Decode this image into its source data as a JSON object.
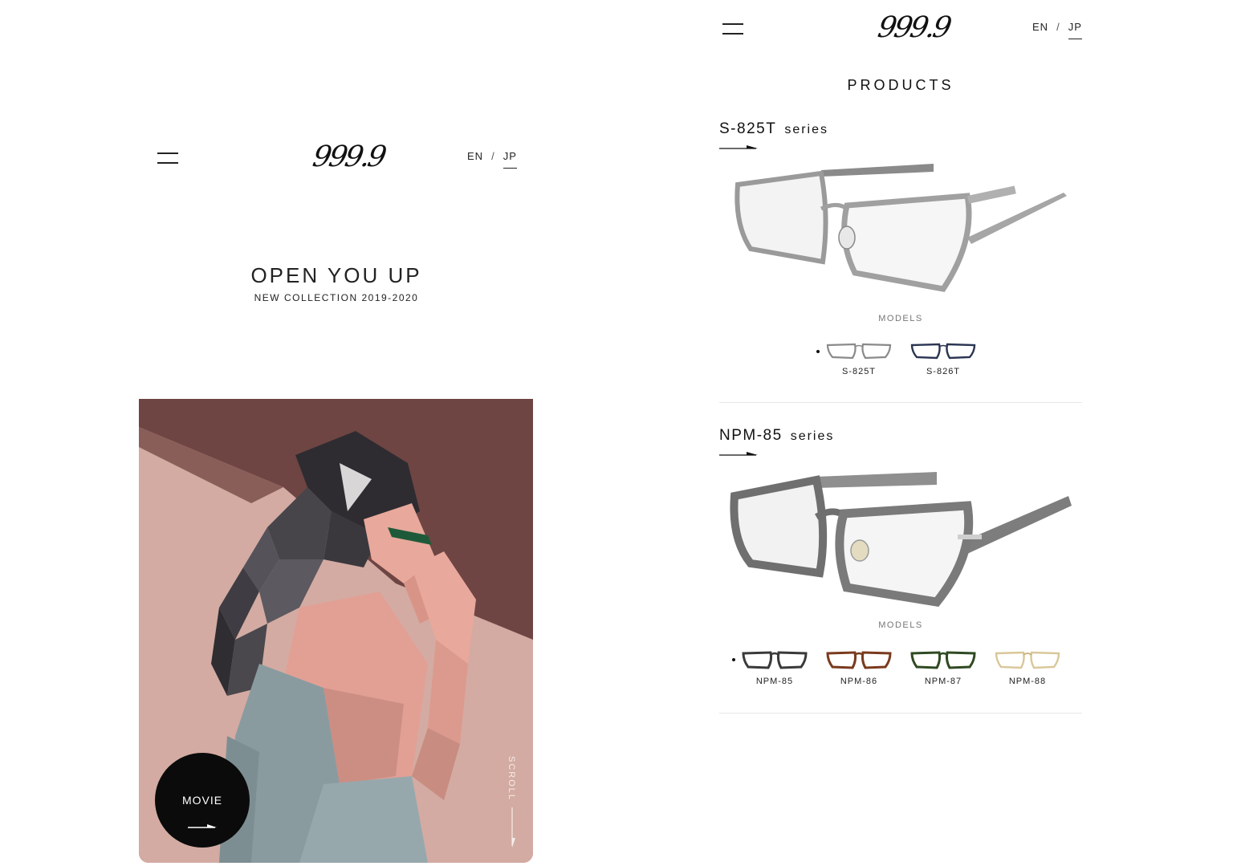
{
  "left_panel": {
    "header": {
      "logo_text": "999.9",
      "lang_en": "EN",
      "lang_separator": "/",
      "lang_jp": "JP"
    },
    "hero": {
      "title": "OPEN YOU UP",
      "subtitle": "NEW COLLECTION 2019-2020"
    },
    "movie_button": {
      "label": "MOVIE"
    },
    "scroll_label": "SCROLL"
  },
  "right_panel": {
    "header": {
      "logo_text": "999.9",
      "lang_en": "EN",
      "lang_separator": "/",
      "lang_jp": "JP"
    },
    "products_title": "PRODUCTS",
    "series": [
      {
        "name": "S-825T",
        "suffix": "series",
        "models_label": "MODELS",
        "models": [
          {
            "code": "S-825T",
            "color": "#8a8a8a",
            "selected": true
          },
          {
            "code": "S-826T",
            "color": "#2b3552",
            "selected": false
          }
        ]
      },
      {
        "name": "NPM-85",
        "suffix": "series",
        "models_label": "MODELS",
        "models": [
          {
            "code": "NPM-85",
            "color": "#3a3a3a",
            "selected": true
          },
          {
            "code": "NPM-86",
            "color": "#7a3a1e",
            "selected": false
          },
          {
            "code": "NPM-87",
            "color": "#2f4a22",
            "selected": false
          },
          {
            "code": "NPM-88",
            "color": "#d9c79a",
            "selected": false
          }
        ]
      }
    ]
  },
  "colors": {
    "hero_background": "#c9a39a",
    "movie_button": "#0b0b0b",
    "divider": "#e6e6e6"
  }
}
